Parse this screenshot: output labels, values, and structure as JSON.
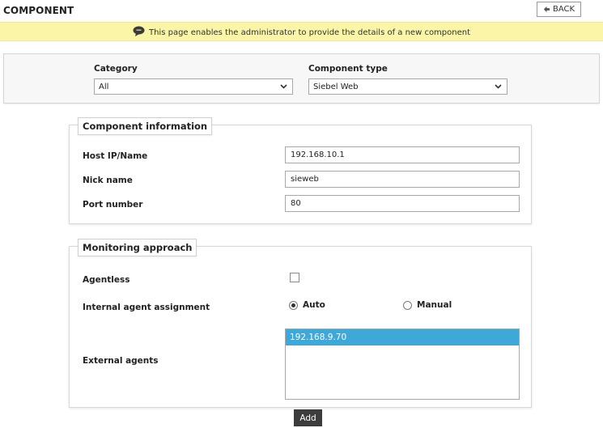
{
  "header": {
    "title": "COMPONENT",
    "back_label": "BACK"
  },
  "banner": {
    "text": "This page enables the administrator to provide the details of a new component"
  },
  "filters": {
    "category_label": "Category",
    "category_value": "All",
    "component_type_label": "Component type",
    "component_type_value": "Siebel Web"
  },
  "component_info": {
    "legend": "Component information",
    "host_label": "Host IP/Name",
    "host_value": "192.168.10.1",
    "nick_label": "Nick name",
    "nick_value": "sieweb",
    "port_label": "Port number",
    "port_value": "80"
  },
  "monitoring": {
    "legend": "Monitoring approach",
    "agentless_label": "Agentless",
    "agentless_checked": false,
    "internal_label": "Internal agent assignment",
    "auto_label": "Auto",
    "manual_label": "Manual",
    "selected_mode": "auto",
    "external_label": "External agents",
    "external_agents": [
      "192.168.9.70"
    ]
  },
  "actions": {
    "add_label": "Add"
  },
  "colors": {
    "banner_bg": "#fbf5a8",
    "selected_row": "#3ea8d8",
    "add_button": "#3c3c3c"
  }
}
